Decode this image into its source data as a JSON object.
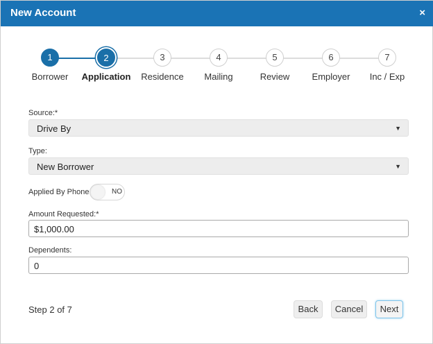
{
  "window": {
    "title": "New Account",
    "close_symbol": "×"
  },
  "stepper": {
    "current": 2,
    "steps": [
      {
        "number": "1",
        "label": "Borrower",
        "state": "done"
      },
      {
        "number": "2",
        "label": "Application",
        "state": "current"
      },
      {
        "number": "3",
        "label": "Residence",
        "state": "pending"
      },
      {
        "number": "4",
        "label": "Mailing",
        "state": "pending"
      },
      {
        "number": "5",
        "label": "Review",
        "state": "pending"
      },
      {
        "number": "6",
        "label": "Employer",
        "state": "pending"
      },
      {
        "number": "7",
        "label": "Inc / Exp",
        "state": "pending"
      }
    ]
  },
  "form": {
    "source": {
      "label": "Source:*",
      "value": "Drive By"
    },
    "type": {
      "label": "Type:",
      "value": "New Borrower"
    },
    "applied_by_phone": {
      "label": "Applied By Phone:",
      "state": "NO"
    },
    "amount_requested": {
      "label": "Amount Requested:*",
      "value": "$1,000.00"
    },
    "dependents": {
      "label": "Dependents:",
      "value": "0"
    }
  },
  "footer": {
    "step_text": "Step 2 of 7",
    "back_label": "Back",
    "cancel_label": "Cancel",
    "next_label": "Next"
  },
  "colors": {
    "header": "#1a73b5",
    "step_active": "#1a6fa8",
    "step_inactive": "#dcdcdc",
    "next_focus": "#7fc4ea"
  }
}
